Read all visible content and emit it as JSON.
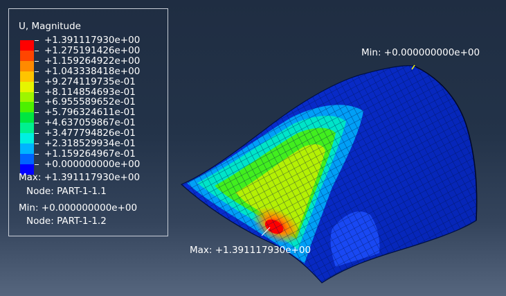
{
  "legend": {
    "title": "U, Magnitude",
    "entries": [
      {
        "label": "+1.391117930e+00",
        "color": "#ff0000"
      },
      {
        "label": "+1.275191426e+00",
        "color": "#ff4500"
      },
      {
        "label": "+1.159264922e+00",
        "color": "#ff8a00"
      },
      {
        "label": "+1.043338418e+00",
        "color": "#ffc400"
      },
      {
        "label": "+9.274119735e-01",
        "color": "#e6f500"
      },
      {
        "label": "+8.114854693e-01",
        "color": "#9ef500"
      },
      {
        "label": "+6.955589652e-01",
        "color": "#4df000"
      },
      {
        "label": "+5.796324611e-01",
        "color": "#00e640"
      },
      {
        "label": "+4.637059867e-01",
        "color": "#00f08f"
      },
      {
        "label": "+3.477794826e-01",
        "color": "#00f0e0"
      },
      {
        "label": "+2.318529934e-01",
        "color": "#00b4ff"
      },
      {
        "label": "+1.159264967e-01",
        "color": "#0064ff"
      },
      {
        "label": "+0.000000000e+00",
        "color": "#0000ff"
      }
    ],
    "max_line": "Max: +1.391117930e+00",
    "max_node": "Node: PART-1-1.1",
    "min_line": "Min: +0.000000000e+00",
    "min_node": "Node: PART-1-1.2"
  },
  "viewport": {
    "min_label": "Min: +0.000000000e+00",
    "max_label": "Max: +1.391117930e+00"
  }
}
